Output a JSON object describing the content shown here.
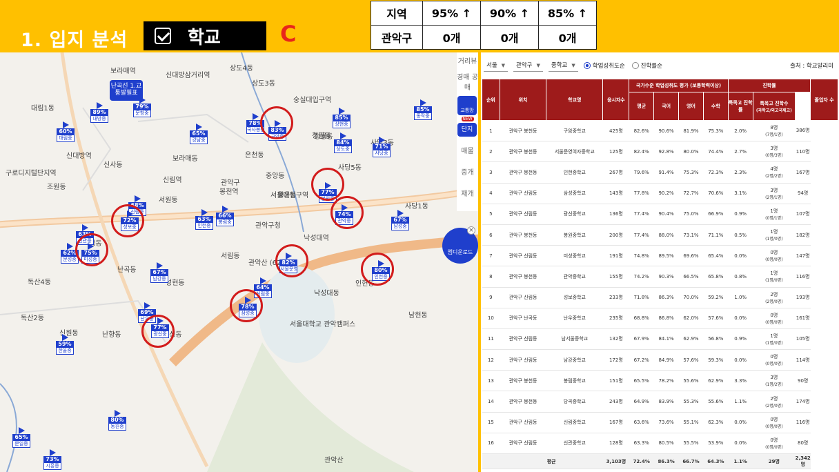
{
  "header": {
    "title": "1. 입지 분석",
    "category": "학교",
    "grade": "C"
  },
  "summary": {
    "header": [
      "지역",
      "95% ↑",
      "90% ↑",
      "85% ↑"
    ],
    "row": [
      "관악구",
      "0개",
      "0개",
      "0개"
    ]
  },
  "map": {
    "places": [
      "신림역",
      "봉천역",
      "서울대입구역",
      "신대방역",
      "신대방삼거리역",
      "낙성대역",
      "관악구청",
      "보라매역",
      "숭실대입구역",
      "구로디지털단지역",
      "조원동",
      "신사동",
      "서원동",
      "청룡동",
      "은천동",
      "중앙동",
      "사당5동",
      "남현동",
      "낙성대동",
      "성현동",
      "보라매동",
      "독산4동",
      "독산2동",
      "난곡동",
      "난향동",
      "서울대학교 관악캠퍼스",
      "관악산",
      "상도4동",
      "상도3동",
      "대림1동",
      "사당3동",
      "사당1동",
      "행운동",
      "서림동",
      "삼성동",
      "미성동",
      "신원동",
      "청림동",
      "인헌동",
      "관악산 (629m)",
      "관악구"
    ],
    "side_items": [
      "거리뷰",
      "경매 공매",
      "교통망",
      "단지",
      "매물",
      "중개",
      "재개"
    ],
    "new_badge": "NEW",
    "round_btn": "엠디운로드",
    "bus_stop": "난곡선\n1.교통발필표"
  },
  "map_markers": [
    {
      "pct": "89%",
      "name": "대방중"
    },
    {
      "pct": "79%",
      "name": "문창중"
    },
    {
      "pct": "60%",
      "name": "대림중"
    },
    {
      "pct": "78%",
      "name": "국사봉중"
    },
    {
      "pct": "83%",
      "name": "구암중"
    },
    {
      "pct": "65%",
      "name": "강남중"
    },
    {
      "pct": "85%",
      "name": "상현중"
    },
    {
      "pct": "84%",
      "name": "상도중"
    },
    {
      "pct": "85%",
      "name": "동작중"
    },
    {
      "pct": "71%",
      "name": "사당중"
    },
    {
      "pct": "77%",
      "name": "봉원중"
    },
    {
      "pct": "74%",
      "name": "관악중"
    },
    {
      "pct": "67%",
      "name": "남성중"
    },
    {
      "pct": "68%",
      "name": "신림중"
    },
    {
      "pct": "72%",
      "name": "성보중"
    },
    {
      "pct": "63%",
      "name": "신관중"
    },
    {
      "pct": "66%",
      "name": "봉림중"
    },
    {
      "pct": "63%",
      "name": "인헌중"
    },
    {
      "pct": "62%",
      "name": "문성중"
    },
    {
      "pct": "75%",
      "name": "미성중"
    },
    {
      "pct": "67%",
      "name": "남강중"
    },
    {
      "pct": "82%",
      "name": "서울문영여자중"
    },
    {
      "pct": "80%",
      "name": "인헌중"
    },
    {
      "pct": "64%",
      "name": "신림중"
    },
    {
      "pct": "78%",
      "name": "삼성중"
    },
    {
      "pct": "69%",
      "name": "난우중"
    },
    {
      "pct": "77%",
      "name": "광신중"
    },
    {
      "pct": "59%",
      "name": "한울중"
    },
    {
      "pct": "80%",
      "name": "동원중"
    },
    {
      "pct": "65%",
      "name": "문일중"
    },
    {
      "pct": "73%",
      "name": "시흥중"
    }
  ],
  "filters": {
    "region": "서울",
    "district": "관악구",
    "level": "중학교",
    "radio_1": "학업성취도순",
    "radio_2": "진학률순",
    "source": "출처 : 학교알리미"
  },
  "table": {
    "headers": {
      "rank": "순위",
      "loc": "위치",
      "school": "학교명",
      "applicants": "응시자수",
      "group_eval": "국가수준 학업성취도 평가 (보통학력이상)",
      "avg": "평균",
      "kor": "국어",
      "eng": "영어",
      "math": "수학",
      "group_adv": "진학률",
      "special": "특목고 진학률",
      "special_cnt": "특목고 진학수",
      "special_sub": "(과학고/외고국제고)",
      "grads": "졸업자 수"
    },
    "rows": [
      [
        "1",
        "관악구 봉천동",
        "구암중학교",
        "425명",
        "82.6%",
        "90.6%",
        "81.9%",
        "75.3%",
        "2.0%",
        "8명",
        "(7명/1명)",
        "386명"
      ],
      [
        "2",
        "관악구 봉천동",
        "서울문영여자중학교",
        "125명",
        "82.4%",
        "92.8%",
        "80.0%",
        "74.4%",
        "2.7%",
        "3명",
        "(0명/3명)",
        "110명"
      ],
      [
        "3",
        "관악구 봉천동",
        "인헌중학교",
        "267명",
        "79.6%",
        "91.4%",
        "75.3%",
        "72.3%",
        "2.3%",
        "4명",
        "(2명/2명)",
        "167명"
      ],
      [
        "4",
        "관악구 신림동",
        "삼성중학교",
        "143명",
        "77.8%",
        "90.2%",
        "72.7%",
        "70.6%",
        "3.1%",
        "3명",
        "(2명/1명)",
        "94명"
      ],
      [
        "5",
        "관악구 신림동",
        "광신중학교",
        "136명",
        "77.4%",
        "90.4%",
        "75.0%",
        "66.9%",
        "0.9%",
        "1명",
        "(0명/1명)",
        "107명"
      ],
      [
        "6",
        "관악구 봉천동",
        "봉원중학교",
        "200명",
        "77.4%",
        "88.0%",
        "73.1%",
        "71.1%",
        "0.5%",
        "1명",
        "(1명/0명)",
        "182명"
      ],
      [
        "7",
        "관악구 신림동",
        "미성중학교",
        "191명",
        "74.8%",
        "89.5%",
        "69.6%",
        "65.4%",
        "0.0%",
        "0명",
        "(0명/0명)",
        "147명"
      ],
      [
        "8",
        "관악구 봉천동",
        "관악중학교",
        "155명",
        "74.2%",
        "90.3%",
        "66.5%",
        "65.8%",
        "0.8%",
        "1명",
        "(1명/0명)",
        "116명"
      ],
      [
        "9",
        "관악구 신림동",
        "성보중학교",
        "233명",
        "71.8%",
        "86.3%",
        "70.0%",
        "59.2%",
        "1.0%",
        "2명",
        "(2명/0명)",
        "193명"
      ],
      [
        "10",
        "관악구 난곡동",
        "난우중학교",
        "235명",
        "68.8%",
        "86.8%",
        "62.0%",
        "57.6%",
        "0.0%",
        "0명",
        "(0명/0명)",
        "161명"
      ],
      [
        "11",
        "관악구 신림동",
        "남서울중학교",
        "132명",
        "67.9%",
        "84.1%",
        "62.9%",
        "56.8%",
        "0.9%",
        "1명",
        "(1명/0명)",
        "105명"
      ],
      [
        "12",
        "관악구 신림동",
        "남강중학교",
        "172명",
        "67.2%",
        "84.9%",
        "57.6%",
        "59.3%",
        "0.0%",
        "0명",
        "(0명/0명)",
        "114명"
      ],
      [
        "13",
        "관악구 봉천동",
        "봉림중학교",
        "151명",
        "65.5%",
        "78.2%",
        "55.6%",
        "62.9%",
        "3.3%",
        "3명",
        "(1명/2명)",
        "90명"
      ],
      [
        "14",
        "관악구 봉천동",
        "당곡중학교",
        "243명",
        "64.9%",
        "83.9%",
        "55.3%",
        "55.6%",
        "1.1%",
        "2명",
        "(2명/0명)",
        "174명"
      ],
      [
        "15",
        "관악구 신림동",
        "신림중학교",
        "167명",
        "63.6%",
        "73.6%",
        "55.1%",
        "62.3%",
        "0.0%",
        "0명",
        "(0명/0명)",
        "116명"
      ],
      [
        "16",
        "관악구 신림동",
        "신관중학교",
        "128명",
        "63.3%",
        "80.5%",
        "55.5%",
        "53.9%",
        "0.0%",
        "0명",
        "(0명/0명)",
        "80명"
      ]
    ],
    "total": [
      "평균",
      "3,103명",
      "72.4%",
      "86.3%",
      "66.7%",
      "64.3%",
      "1.1%",
      "29명",
      "2,342명"
    ]
  }
}
